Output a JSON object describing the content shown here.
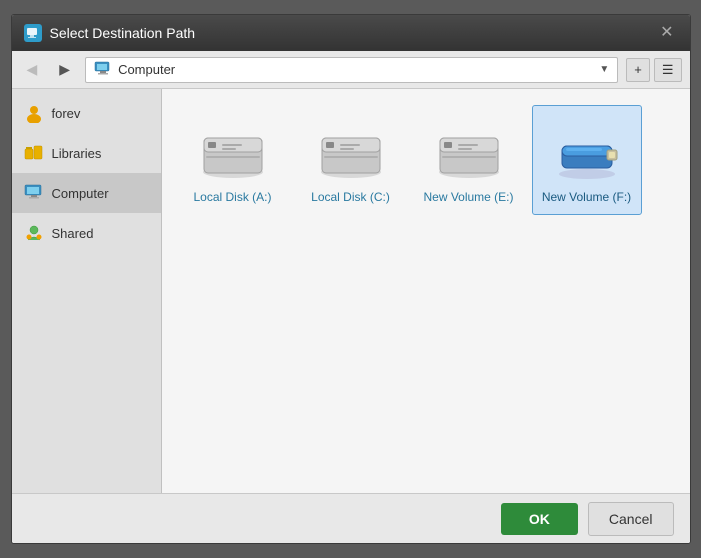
{
  "dialog": {
    "title": "Select Destination Path",
    "close_label": "✕"
  },
  "toolbar": {
    "back_label": "◀",
    "forward_label": "▶",
    "path_label": "Computer",
    "dropdown_label": "▼",
    "new_folder_label": "+",
    "list_view_label": "☰"
  },
  "sidebar": {
    "items": [
      {
        "id": "forev",
        "label": "forev",
        "icon": "user-icon",
        "active": false
      },
      {
        "id": "libraries",
        "label": "Libraries",
        "icon": "libraries-icon",
        "active": false
      },
      {
        "id": "computer",
        "label": "Computer",
        "icon": "computer-icon",
        "active": true
      },
      {
        "id": "shared",
        "label": "Shared",
        "icon": "shared-icon",
        "active": false
      }
    ]
  },
  "files": {
    "items": [
      {
        "id": "drive-a",
        "label": "Local Disk (A:)",
        "selected": false,
        "color": "gray"
      },
      {
        "id": "drive-c",
        "label": "Local Disk (C:)",
        "selected": false,
        "color": "gray"
      },
      {
        "id": "drive-e",
        "label": "New Volume (E:)",
        "selected": false,
        "color": "gray"
      },
      {
        "id": "drive-f",
        "label": "New Volume (F:)",
        "selected": true,
        "color": "blue"
      }
    ]
  },
  "buttons": {
    "ok_label": "OK",
    "cancel_label": "Cancel"
  }
}
